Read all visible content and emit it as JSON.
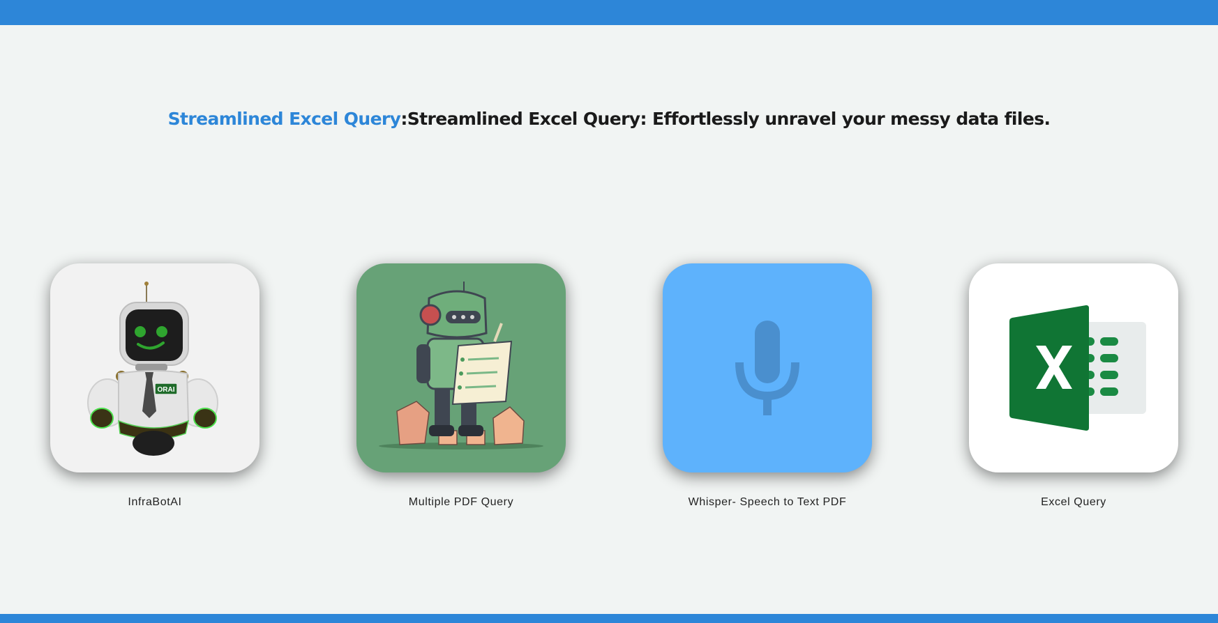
{
  "header": {
    "accent_title": "Streamlined Excel Query",
    "separator": ":",
    "tagline": "Streamlined Excel Query: Effortlessly unravel your messy data files."
  },
  "theme": {
    "accent": "#2d86d8",
    "background": "#f1f4f3"
  },
  "apps": [
    {
      "label": "InfraBotAI",
      "icon": "robot-avatar-icon",
      "tile_color": "#f2f2f2",
      "badge_text": "ORAI"
    },
    {
      "label": "Multiple PDF Query",
      "icon": "robot-reading-document-icon",
      "tile_color": "#67a277"
    },
    {
      "label": "Whisper- Speech to Text PDF",
      "icon": "microphone-icon",
      "tile_color": "#5eb2fc"
    },
    {
      "label": "Excel Query",
      "icon": "excel-icon",
      "tile_color": "#ffffff"
    }
  ]
}
